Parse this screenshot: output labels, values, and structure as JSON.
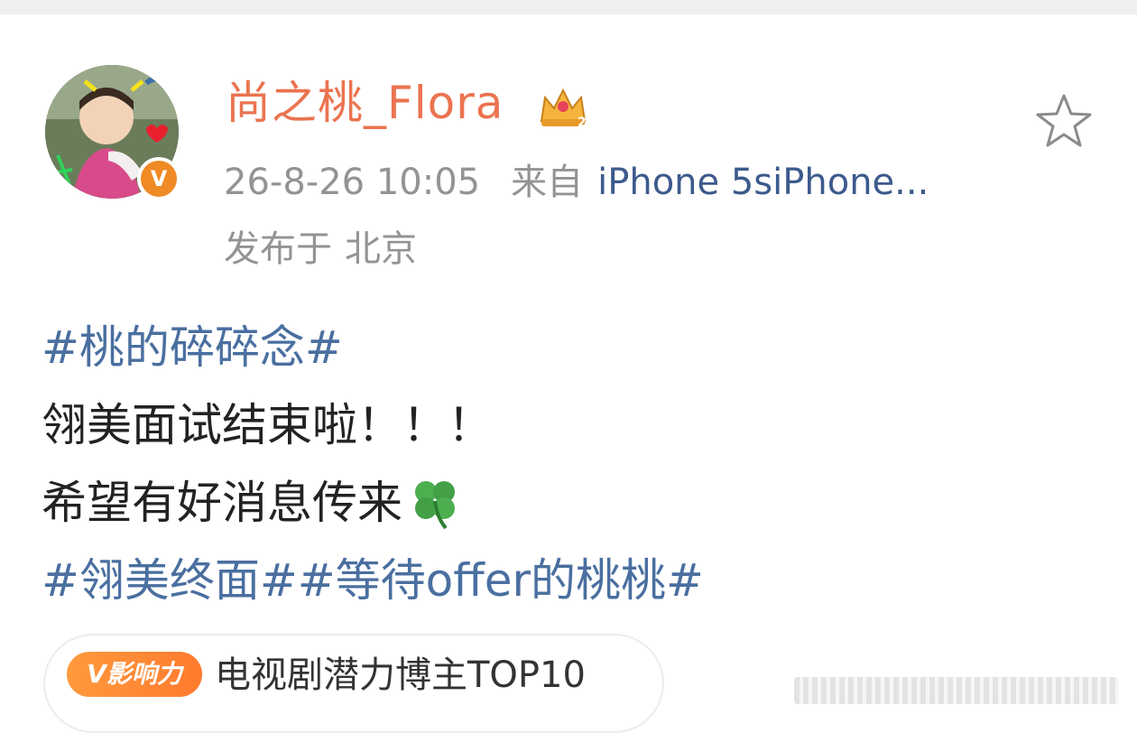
{
  "post": {
    "username": "尚之桃_Flora",
    "time": "26-8-26 10:05",
    "source_prefix": "来自",
    "source": "iPhone 5siPhone...",
    "location_prefix": "发布于",
    "location": "北京",
    "lines": [
      "#桃的碎碎念#",
      "翎美面试结束啦！！！",
      "希望有好消息传来",
      "#翎美终面##等待offer的桃桃#"
    ],
    "influence_tag": "V影响力",
    "influence_text": "电视剧潜力博主TOP10"
  },
  "icons": {
    "verified": "verified-v-icon",
    "crown": "crown-icon",
    "star": "favorite-star-icon",
    "clover": "four-leaf-clover-icon"
  },
  "colors": {
    "username": "#eb7350",
    "hashtag": "#4a6fa0",
    "source": "#3c5a8c",
    "verified": "#f08a24"
  }
}
